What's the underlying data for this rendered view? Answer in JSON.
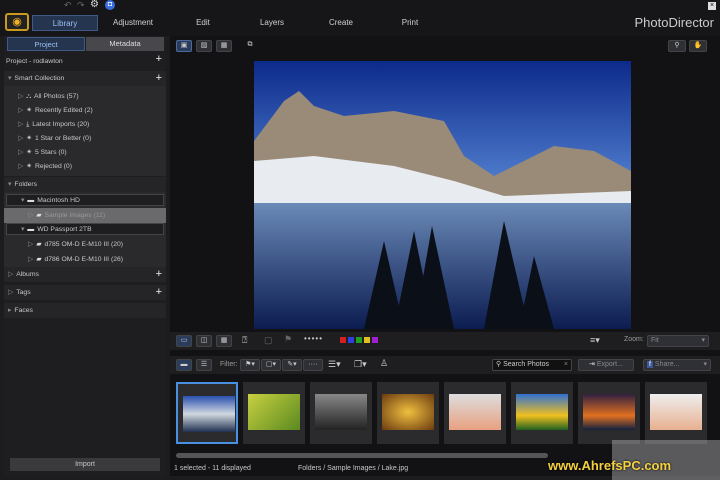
{
  "app": {
    "title": "PhotoDirector"
  },
  "nav": {
    "tabs": [
      {
        "label": "Library",
        "active": true
      },
      {
        "label": "Adjustment"
      },
      {
        "label": "Edit"
      },
      {
        "label": "Layers"
      },
      {
        "label": "Create"
      },
      {
        "label": "Print"
      }
    ]
  },
  "left": {
    "tabs": [
      "Project",
      "Metadata"
    ],
    "project": "Project - rodlawton",
    "smart_collection": {
      "label": "Smart Collection",
      "items": [
        "All Photos (57)",
        "Recently Edited (2)",
        "Latest Imports (20)",
        "1 Star or Better (0)",
        "5 Stars (0)",
        "Rejected (0)"
      ]
    },
    "folders": {
      "label": "Folders",
      "drives": [
        {
          "label": "Macintosh HD",
          "items": [
            "Sample Images (11)"
          ]
        },
        {
          "label": "WD Passport 2TB",
          "items": [
            "d785 OM-D E-M10 III (20)",
            "d786 OM-D E-M10 III (26)"
          ]
        }
      ]
    },
    "albums": "Albums",
    "tags": "Tags",
    "faces": "Faces",
    "import": "Import"
  },
  "toolbar": {
    "zoom_label": "Zoom:",
    "zoom_value": "Fit",
    "filter_label": "Filter:",
    "search_placeholder": "Search Photos",
    "export": "Export...",
    "share": "Share...",
    "color_labels": [
      "#d02020",
      "#3040e0",
      "#20a020",
      "#e0c020",
      "#a020d0"
    ]
  },
  "status": {
    "selection": "1 selected - 11 displayed",
    "path": "Folders / Sample Images / Lake.jpg"
  },
  "watermark": "www.AhrefsPC.com"
}
